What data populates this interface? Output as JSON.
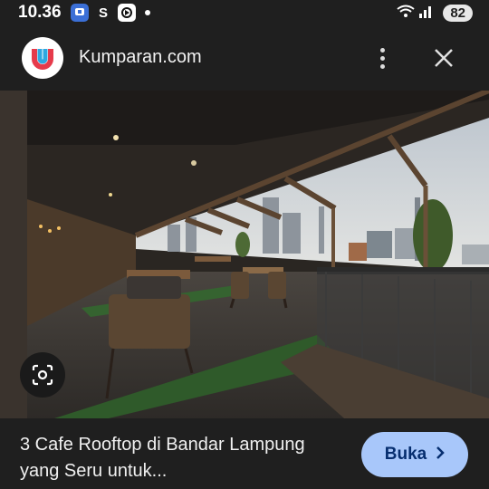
{
  "status_bar": {
    "time": "10.36",
    "app_icons": [
      "messaging-app-icon",
      "s-app-icon",
      "media-app-icon"
    ],
    "s_label": "S",
    "signal": "wifi-signal-icon",
    "battery": "82"
  },
  "header": {
    "site_name": "Kumparan.com",
    "logo_icon": "kumparan-logo-icon"
  },
  "image": {
    "description_icon": "rooftop-cafe-photo"
  },
  "caption": {
    "title": "3 Cafe Rooftop di Bandar Lampung yang Seru untuk..."
  },
  "actions": {
    "open_label": "Buka",
    "lens_icon": "visual-search-icon"
  },
  "colors": {
    "background": "#1f1f1f",
    "button": "#a8c7fa",
    "button_text": "#062e6f"
  }
}
